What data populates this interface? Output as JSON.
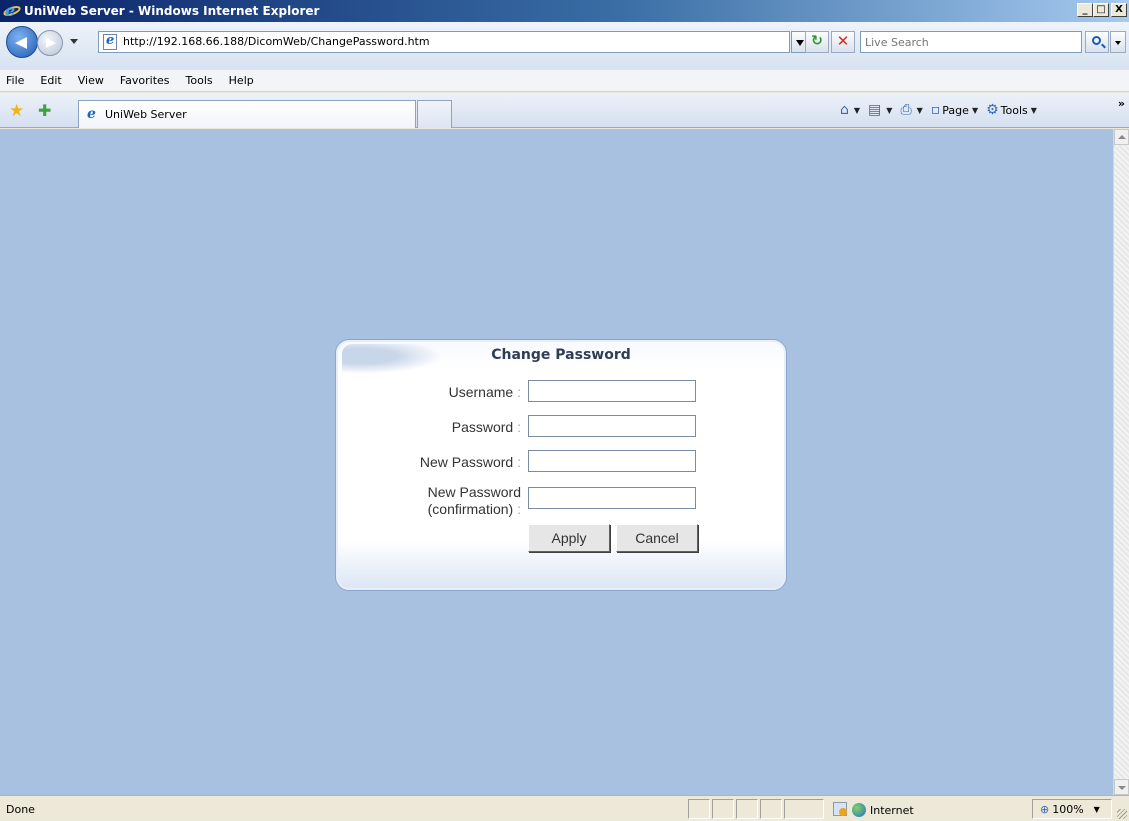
{
  "window": {
    "title": "UniWeb Server - Windows Internet Explorer",
    "minimize_label": "_",
    "maximize_label": "□",
    "close_label": "X"
  },
  "address_bar": {
    "url": "http://192.168.66.188/DicomWeb/ChangePassword.htm"
  },
  "search": {
    "placeholder": "Live Search"
  },
  "menu": {
    "items": [
      "File",
      "Edit",
      "View",
      "Favorites",
      "Tools",
      "Help"
    ]
  },
  "tabs": {
    "active_label": "UniWeb Server"
  },
  "command_bar": {
    "page_label": "Page",
    "tools_label": "Tools",
    "overflow_label": "»"
  },
  "dialog": {
    "title": "Change Password",
    "fields": [
      {
        "label": "Username",
        "value": ""
      },
      {
        "label": "Password",
        "value": ""
      },
      {
        "label": "New Password",
        "value": ""
      },
      {
        "label": "New Password (confirmation)",
        "label_line1": "New Password",
        "label_line2": "(confirmation)",
        "value": ""
      }
    ],
    "colon": " :",
    "apply_label": "Apply",
    "cancel_label": "Cancel"
  },
  "status_bar": {
    "status": "Done",
    "zone": "Internet",
    "zoom": "100%"
  },
  "colors": {
    "page_background": "#a9c1e1",
    "title_bar_start": "#0a246a",
    "dialog_title": "#2f3e55"
  }
}
